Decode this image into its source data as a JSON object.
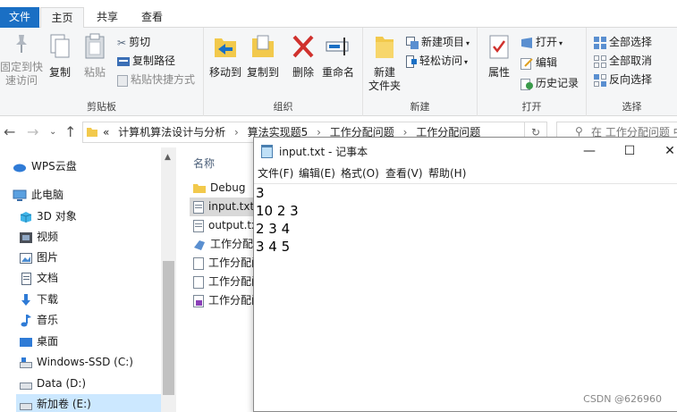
{
  "tabs": {
    "file": "文件",
    "home": "主页",
    "share": "共享",
    "view": "查看"
  },
  "clipboard": {
    "pin": [
      "固定到快",
      "速访问"
    ],
    "copy": "复制",
    "paste": "粘贴",
    "cut": "剪切",
    "copy_path": "复制路径",
    "paste_shortcut": "粘贴快捷方式",
    "label": "剪贴板"
  },
  "organize": {
    "move_to": "移动到",
    "copy_to": "复制到",
    "delete": "删除",
    "rename": "重命名",
    "label": "组织"
  },
  "new_group": {
    "new_folder": [
      "新建",
      "文件夹"
    ],
    "new_item": "新建项目",
    "easy_access": "轻松访问",
    "label": "新建"
  },
  "open_group": {
    "properties": "属性",
    "open": "打开",
    "edit": "编辑",
    "history": "历史记录",
    "label": "打开"
  },
  "select_group": {
    "select_all": "全部选择",
    "select_none": "全部取消",
    "invert": "反向选择",
    "label": "选择"
  },
  "address": {
    "prefix": "«",
    "parts": [
      "计算机算法设计与分析",
      "算法实现题5",
      "工作分配问题",
      "工作分配问题"
    ],
    "separator": "›",
    "search_placeholder": "在 工作分配问题 中"
  },
  "nav": {
    "items": [
      {
        "label": "WPS云盘",
        "icon": "cloud-icon"
      },
      {
        "label": "此电脑",
        "icon": "computer-icon"
      },
      {
        "label": "3D 对象",
        "icon": "cube-icon"
      },
      {
        "label": "视频",
        "icon": "video-icon"
      },
      {
        "label": "图片",
        "icon": "picture-icon"
      },
      {
        "label": "文档",
        "icon": "document-icon"
      },
      {
        "label": "下载",
        "icon": "download-icon"
      },
      {
        "label": "音乐",
        "icon": "music-icon"
      },
      {
        "label": "桌面",
        "icon": "desktop-icon"
      },
      {
        "label": "Windows-SSD (C:)",
        "icon": "drive-c-icon"
      },
      {
        "label": "Data (D:)",
        "icon": "drive-d-icon"
      },
      {
        "label": "新加卷 (E:)",
        "icon": "drive-e-icon"
      }
    ]
  },
  "files": {
    "column_name": "名称",
    "items": [
      {
        "label": "Debug",
        "icon": "folder-icon"
      },
      {
        "label": "input.txt",
        "icon": "text-file-icon"
      },
      {
        "label": "output.txt",
        "icon": "text-file-icon"
      },
      {
        "label": "工作分配问题",
        "icon": "solution-file-icon"
      },
      {
        "label": "工作分配问题",
        "icon": "file-icon"
      },
      {
        "label": "工作分配问题",
        "icon": "file-icon"
      },
      {
        "label": "工作分配问题",
        "icon": "project-file-icon"
      }
    ]
  },
  "notepad": {
    "title": "input.txt - 记事本",
    "menu": [
      "文件(F)",
      "编辑(E)",
      "格式(O)",
      "查看(V)",
      "帮助(H)"
    ],
    "lines": [
      "3",
      "10 2 3",
      "2 3 4",
      "3 4 5"
    ],
    "minimize": "—",
    "maximize": "☐",
    "close": "✕"
  },
  "watermark": "CSDN @626960",
  "colors": {
    "accent": "#1a6fc4",
    "selection": "#cce8ff",
    "delete_red": "#d0312d",
    "folder_yellow": "#f2c94c"
  }
}
